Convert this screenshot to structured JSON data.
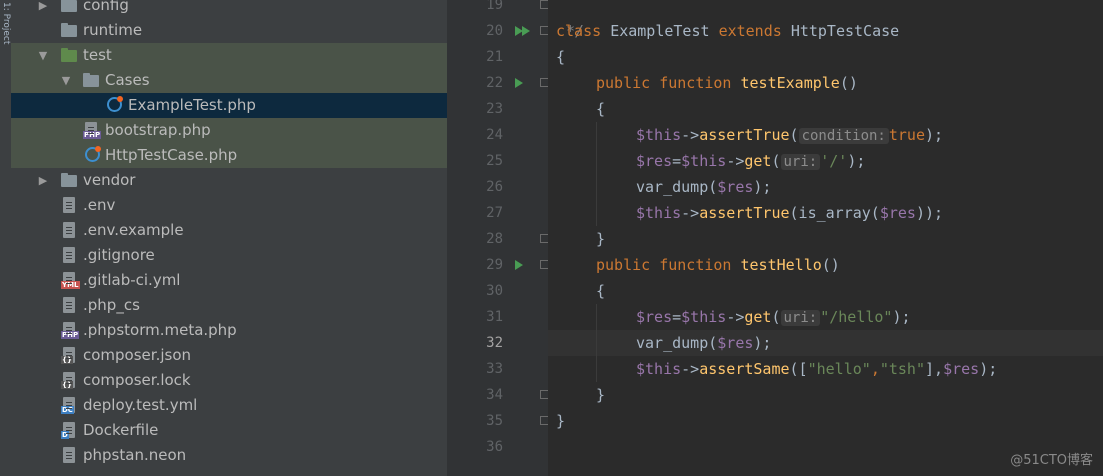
{
  "sidebar_stripe": {
    "label": "1: Project"
  },
  "tree": {
    "items": [
      {
        "label": "config",
        "type": "folder",
        "arrow": "▶"
      },
      {
        "label": "runtime",
        "type": "folder",
        "arrow": ""
      },
      {
        "label": "test",
        "type": "folder-green",
        "arrow": "▼"
      },
      {
        "label": "Cases",
        "type": "folder",
        "arrow": "▼"
      },
      {
        "label": "ExampleTest.php",
        "type": "class",
        "arrow": ""
      },
      {
        "label": "bootstrap.php",
        "type": "file",
        "badge": "PHP",
        "arrow": ""
      },
      {
        "label": "HttpTestCase.php",
        "type": "class",
        "arrow": ""
      },
      {
        "label": "vendor",
        "type": "folder",
        "arrow": "▶"
      },
      {
        "label": ".env",
        "type": "file",
        "arrow": ""
      },
      {
        "label": ".env.example",
        "type": "file",
        "arrow": ""
      },
      {
        "label": ".gitignore",
        "type": "file",
        "arrow": ""
      },
      {
        "label": ".gitlab-ci.yml",
        "type": "file",
        "badge": "YML",
        "arrow": ""
      },
      {
        "label": ".php_cs",
        "type": "file",
        "arrow": ""
      },
      {
        "label": ".phpstorm.meta.php",
        "type": "file",
        "badge": "PHP",
        "arrow": ""
      },
      {
        "label": "composer.json",
        "type": "file",
        "badge": "{}",
        "arrow": ""
      },
      {
        "label": "composer.lock",
        "type": "file",
        "badge": "{}",
        "arrow": ""
      },
      {
        "label": "deploy.test.yml",
        "type": "file",
        "badge": "DC",
        "arrow": ""
      },
      {
        "label": "Dockerfile",
        "type": "file",
        "badge": "D",
        "arrow": ""
      },
      {
        "label": "phpstan.neon",
        "type": "file",
        "arrow": ""
      }
    ]
  },
  "gutter": {
    "line_numbers": [
      "19",
      "20",
      "21",
      "22",
      "23",
      "24",
      "25",
      "26",
      "27",
      "28",
      "29",
      "30",
      "31",
      "32",
      "33",
      "34",
      "35",
      "36"
    ],
    "current_line": "32"
  },
  "code": {
    "l19": "*/",
    "l20_kw1": "class",
    "l20_name": "ExampleTest",
    "l20_kw2": "extends",
    "l20_parent": "HttpTestCase",
    "l21": "{",
    "l22_kw": "public function",
    "l22_fn": "testExample",
    "l22_tail": "()",
    "l23": "{",
    "l24_var": "$this",
    "l24_arrow": "->",
    "l24_fn": "assertTrue",
    "l24_open": "(",
    "l24_hint": "condition:",
    "l24_val": "true",
    "l24_close": ");",
    "l25_var1": "$res",
    "l25_eq": "=",
    "l25_var2": "$this",
    "l25_arrow": "->",
    "l25_fn": "get",
    "l25_open": "(",
    "l25_hint": "uri:",
    "l25_str": "'/'",
    "l25_close": ");",
    "l26_call": "var_dump(",
    "l26_var": "$res",
    "l26_close": ");",
    "l27_var": "$this",
    "l27_arrow": "->",
    "l27_fn": "assertTrue",
    "l27_mid": "(is_array(",
    "l27_var2": "$res",
    "l27_close": "));",
    "l28": "}",
    "l29_kw": "public function",
    "l29_fn": "testHello",
    "l29_tail": "()",
    "l30": "{",
    "l31_var1": "$res",
    "l31_eq": "=",
    "l31_var2": "$this",
    "l31_arrow": "->",
    "l31_fn": "get",
    "l31_open": "(",
    "l31_hint": "uri:",
    "l31_str": "\"/hello\"",
    "l31_close": ");",
    "l32_call": "var_dump(",
    "l32_var": "$res",
    "l32_close": ");",
    "l33_var": "$this",
    "l33_arrow": "->",
    "l33_fn": "assertSame",
    "l33_open": "([",
    "l33_s1": "\"hello\"",
    "l33_comma1": ",",
    "l33_s2": "\"tsh\"",
    "l33_mid": "],",
    "l33_var2": "$res",
    "l33_close": ");",
    "l34": "}",
    "l35": "}"
  },
  "watermark": "@51CTO博客",
  "colors": {
    "keyword": "#cc7832",
    "function": "#ffc66d",
    "variable": "#9876aa",
    "string": "#6a8759",
    "run_icon": "#499c54",
    "selection": "#0d293e",
    "highlight_row": "#4a5348"
  }
}
